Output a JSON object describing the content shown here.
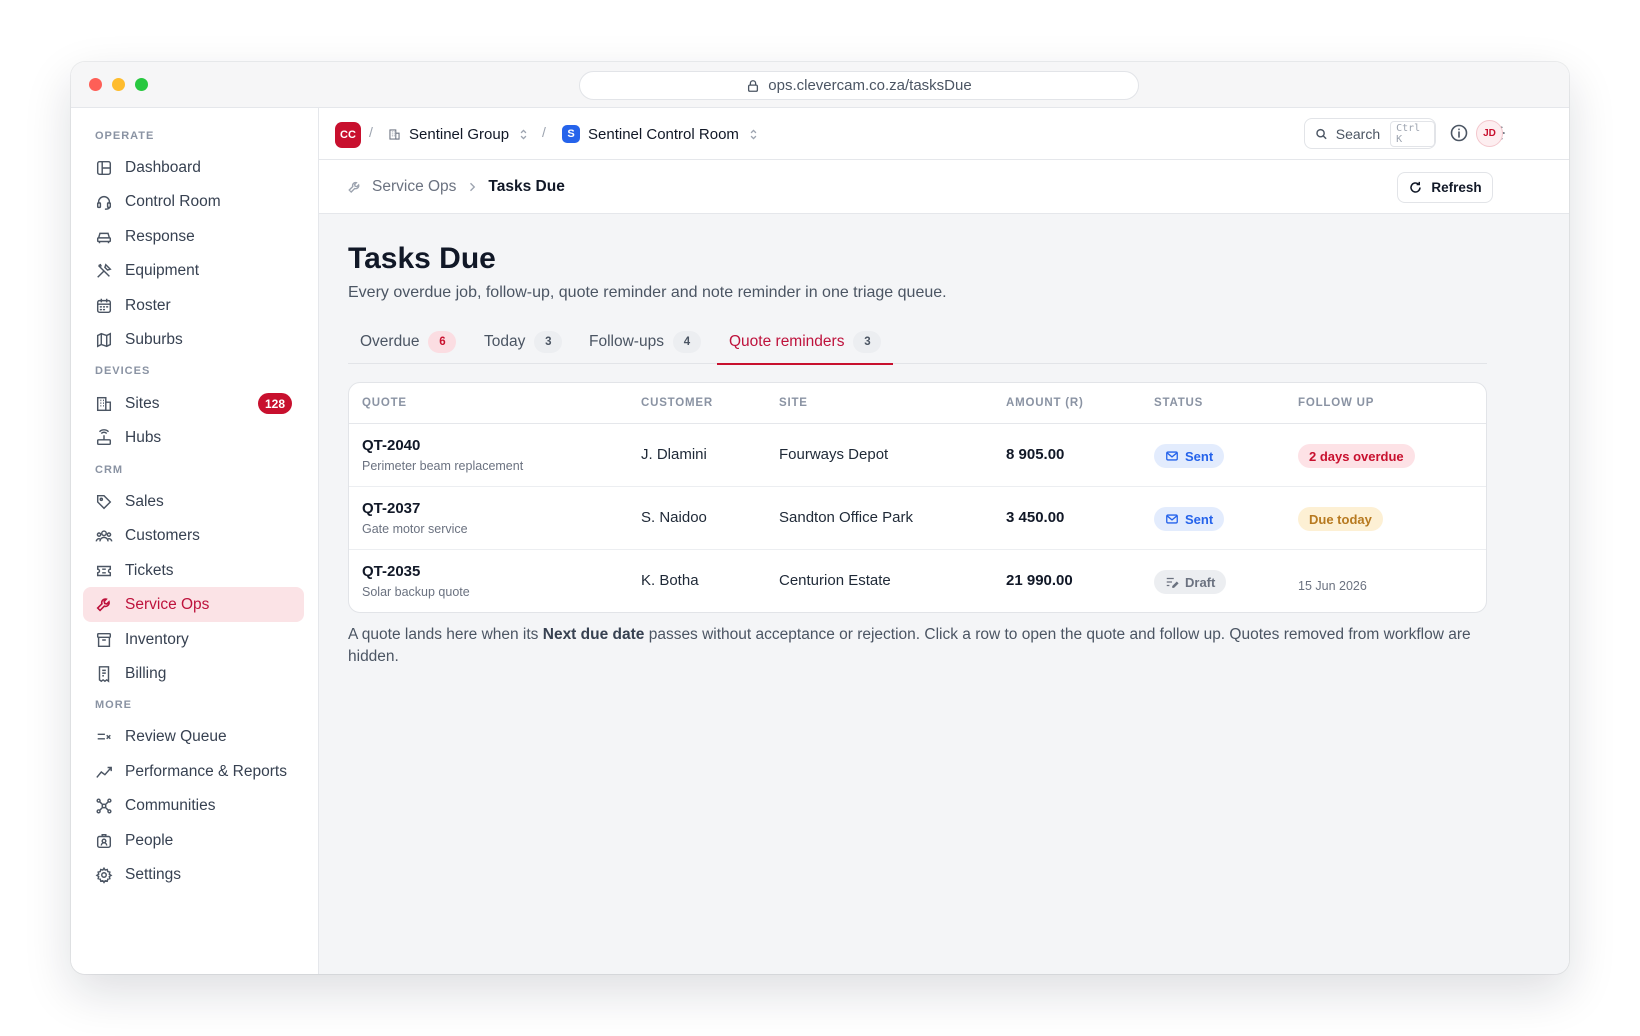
{
  "browser": {
    "url": "ops.clevercam.co.za/tasksDue"
  },
  "sidebar": {
    "sections": [
      "OPERATE",
      "DEVICES",
      "CRM",
      "MORE"
    ],
    "items": [
      {
        "label": "Dashboard",
        "icon": "layout-icon"
      },
      {
        "label": "Control Room",
        "icon": "headset-icon"
      },
      {
        "label": "Response",
        "icon": "car-icon"
      },
      {
        "label": "Equipment",
        "icon": "tools-icon"
      },
      {
        "label": "Roster",
        "icon": "calendar-icon"
      },
      {
        "label": "Suburbs",
        "icon": "map-icon"
      },
      {
        "label": "Sites",
        "icon": "building-icon",
        "badge": "128"
      },
      {
        "label": "Hubs",
        "icon": "router-icon"
      },
      {
        "label": "Sales",
        "icon": "tag-icon"
      },
      {
        "label": "Customers",
        "icon": "users-icon"
      },
      {
        "label": "Tickets",
        "icon": "ticket-icon"
      },
      {
        "label": "Service Ops",
        "icon": "wrench-icon",
        "active": true
      },
      {
        "label": "Inventory",
        "icon": "archive-icon"
      },
      {
        "label": "Billing",
        "icon": "receipt-icon"
      },
      {
        "label": "Review Queue",
        "icon": "review-icon"
      },
      {
        "label": "Performance & Reports",
        "icon": "chart-line-icon"
      },
      {
        "label": "Communities",
        "icon": "network-icon"
      },
      {
        "label": "People",
        "icon": "id-badge-icon"
      },
      {
        "label": "Settings",
        "icon": "gear-icon"
      }
    ]
  },
  "topbar": {
    "org_logo": "CC",
    "group": "Sentinel Group",
    "room_logo": "S",
    "room": "Sentinel Control Room",
    "search_label": "Search",
    "search_kbd": "Ctrl K",
    "avatar": "JD"
  },
  "breadcrumb": {
    "parent": "Service Ops",
    "current": "Tasks Due"
  },
  "refresh_label": "Refresh",
  "page": {
    "title": "Tasks Due",
    "subtitle": "Every overdue job, follow-up, quote reminder and note reminder in one triage queue."
  },
  "tabs": [
    {
      "label": "Overdue",
      "count": "6"
    },
    {
      "label": "Today",
      "count": "3"
    },
    {
      "label": "Follow-ups",
      "count": "4"
    },
    {
      "label": "Quote reminders",
      "count": "3",
      "active": true
    }
  ],
  "table": {
    "columns": [
      "QUOTE",
      "CUSTOMER",
      "SITE",
      "AMOUNT (R)",
      "STATUS",
      "FOLLOW UP"
    ],
    "rows": [
      {
        "id": "QT-2040",
        "desc": "Perimeter beam replacement",
        "customer": "J. Dlamini",
        "site": "Fourways Depot",
        "amount": "8 905.00",
        "status": "Sent",
        "follow": "2 days overdue"
      },
      {
        "id": "QT-2037",
        "desc": "Gate motor service",
        "customer": "S. Naidoo",
        "site": "Sandton Office Park",
        "amount": "3 450.00",
        "status": "Sent",
        "follow": "Due today"
      },
      {
        "id": "QT-2035",
        "desc": "Solar backup quote",
        "customer": "K. Botha",
        "site": "Centurion Estate",
        "amount": "21 990.00",
        "status": "Draft",
        "follow": "15 Jun 2026"
      }
    ]
  },
  "footnote": {
    "before": "A quote lands here when its ",
    "bold": "Next due date",
    "after": " passes without acceptance or rejection. Click a row to open the quote and follow up. Quotes removed from workflow are hidden."
  },
  "colors": {
    "accent": "#c8102e",
    "active_bg": "#fbe3e6",
    "sent": "#2563eb",
    "due_today": "#b7791f"
  }
}
